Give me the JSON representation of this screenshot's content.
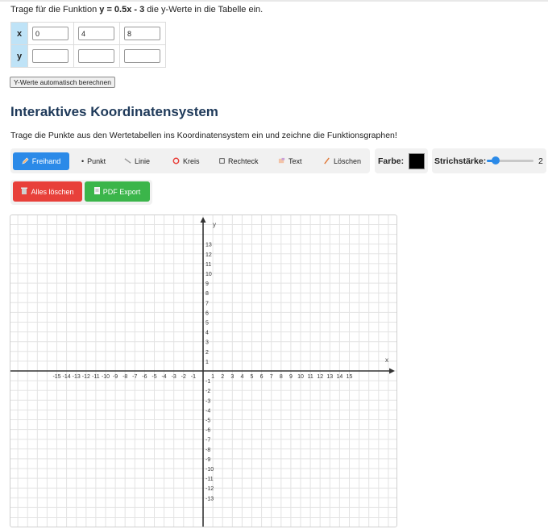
{
  "intro": {
    "prefix": "Trage für die Funktion ",
    "function": "y = 0.5x - 3",
    "suffix": " die y-Werte in die Tabelle ein."
  },
  "table": {
    "x_label": "x",
    "y_label": "y",
    "x_values": [
      "0",
      "4",
      "8"
    ],
    "y_values": [
      "",
      "",
      ""
    ]
  },
  "auto_button": "Y-Werte automatisch berechnen",
  "section_title": "Interaktives Koordinatensystem",
  "instruction": "Trage die Punkte aus den Wertetabellen ins Koordinatensystem ein und zeichne die Funktionsgraphen!",
  "tools": [
    {
      "label": "Freihand",
      "icon": "pencil-icon",
      "active": true
    },
    {
      "label": "Punkt",
      "icon": "dot-icon",
      "active": false
    },
    {
      "label": "Linie",
      "icon": "line-icon",
      "active": false
    },
    {
      "label": "Kreis",
      "icon": "circle-icon",
      "active": false
    },
    {
      "label": "Rechteck",
      "icon": "rectangle-icon",
      "active": false
    },
    {
      "label": "Text",
      "icon": "text-icon",
      "active": false
    },
    {
      "label": "Löschen",
      "icon": "eraser-icon",
      "active": false
    }
  ],
  "color": {
    "label": "Farbe:",
    "value": "#000000"
  },
  "stroke": {
    "label": "Strichstärke:",
    "value": "2",
    "min": 1,
    "max": 10
  },
  "actions": {
    "clear_all": "Alles löschen",
    "pdf_export": "PDF Export"
  },
  "colors": {
    "accent": "#2b8ae8",
    "danger": "#e8403a",
    "success": "#3bb54a",
    "title": "#1f3a5a",
    "table_header": "#bfe3f7"
  },
  "coordinate_system": {
    "x_axis_label": "x",
    "y_axis_label": "y",
    "x_ticks": [
      "-15",
      "-14",
      "-13",
      "-12",
      "-11",
      "-10",
      "-9",
      "-8",
      "-7",
      "-6",
      "-5",
      "-4",
      "-3",
      "-2",
      "-1",
      "1",
      "2",
      "3",
      "4",
      "5",
      "6",
      "7",
      "8",
      "9",
      "10",
      "11",
      "12",
      "13",
      "14",
      "15"
    ],
    "y_ticks": [
      "13",
      "12",
      "11",
      "10",
      "9",
      "8",
      "7",
      "6",
      "5",
      "4",
      "3",
      "2",
      "1",
      "-1",
      "-2",
      "-3",
      "-4",
      "-5",
      "-6",
      "-7",
      "-8",
      "-9",
      "-10",
      "-11",
      "-12",
      "-13"
    ],
    "x_range": [
      -15,
      15
    ],
    "y_range": [
      -13,
      13
    ],
    "grid": true
  }
}
